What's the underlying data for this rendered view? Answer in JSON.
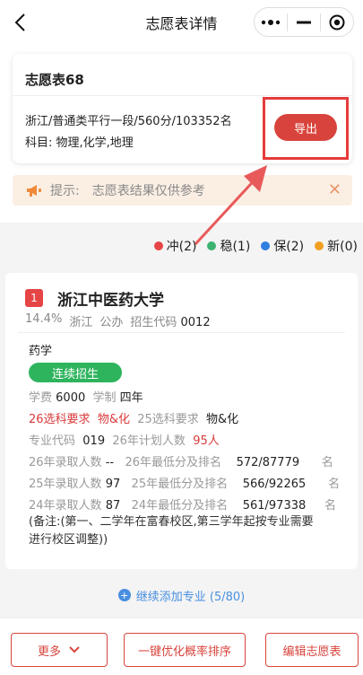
{
  "header": {
    "title": "志愿表详情"
  },
  "volunteer": {
    "name": "志愿表68",
    "info": "浙江/普通类平行一段/560分/103352名",
    "subjects": "科目: 物理,化学,地理",
    "export_label": "导出"
  },
  "tip": {
    "label": "提示:",
    "text": "志愿表结果仅供参考"
  },
  "legend": [
    {
      "label": "冲(2)",
      "color": "#e64545"
    },
    {
      "label": "稳(1)",
      "color": "#3cb371"
    },
    {
      "label": "保(2)",
      "color": "#2f7fe0"
    },
    {
      "label": "新(0)",
      "color": "#f0a020"
    }
  ],
  "school": {
    "rank": "1",
    "name": "浙江中医药大学",
    "percent": "14.4%",
    "province": "浙江",
    "type": "公办",
    "code_label": "招生代码",
    "code": "0012",
    "major": "药学",
    "tag": "连续招生",
    "fee_label": "学费",
    "fee": "6000",
    "years_label": "学制",
    "years": "四年",
    "req26_label": "26选科要求",
    "req26": "物&化",
    "req25_label": "25选科要求",
    "req25": "物&化",
    "major_code_label": "专业代码",
    "major_code": "019",
    "plan26_label": "26年计划人数",
    "plan26": "95人",
    "adm26_label": "26年录取人数",
    "adm26": "--",
    "min26_label": "26年最低分及排名",
    "min26": "572/87779",
    "adm25_label": "25年录取人数",
    "adm25": "97",
    "min25_label": "25年最低分及排名",
    "min25": "566/92265",
    "adm24_label": "24年录取人数",
    "adm24": "87",
    "min24_label": "24年最低分及排名",
    "min24": "561/97338",
    "unit": "名",
    "note": "(备注:(第一、二学年在富春校区,第三学年起按专业需要进行校区调整))"
  },
  "add_more": "继续添加专业 (5/80)",
  "footer": {
    "more": "更多",
    "optimize": "一键优化概率排序",
    "edit": "编辑志愿表"
  }
}
